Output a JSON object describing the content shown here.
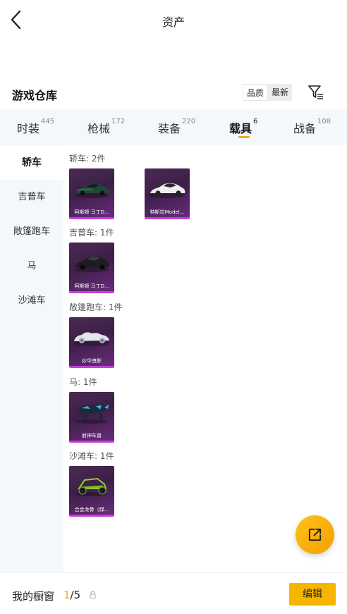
{
  "header": {
    "title": "资产"
  },
  "warehouse": {
    "title": "游戏仓库",
    "sort_options": [
      "品质",
      "最新"
    ],
    "active_sort": "品质"
  },
  "tabs": [
    {
      "label": "时装",
      "count": "445"
    },
    {
      "label": "枪械",
      "count": "172"
    },
    {
      "label": "装备",
      "count": "220"
    },
    {
      "label": "载具",
      "count": "6"
    },
    {
      "label": "战备",
      "count": "108"
    }
  ],
  "active_tab": "载具",
  "sidebar": {
    "items": [
      "轿车",
      "吉普车",
      "敞篷跑车",
      "马",
      "沙滩车"
    ],
    "active": "轿车"
  },
  "sections": [
    {
      "label": "轿车: 2件",
      "items": [
        {
          "name": "阿斯顿·马丁D...",
          "icon": "dark-green-sports-car"
        },
        {
          "name": "特斯拉Model...",
          "icon": "white-tesla-car"
        }
      ]
    },
    {
      "label": "吉普车: 1件",
      "items": [
        {
          "name": "阿斯顿·马丁D...",
          "icon": "dark-suv"
        }
      ]
    },
    {
      "label": "敞篷跑车: 1件",
      "items": [
        {
          "name": "纱华曳影",
          "icon": "white-classic-convertible"
        }
      ]
    },
    {
      "label": "马: 1件",
      "items": [
        {
          "name": "射神车兽",
          "icon": "blue-mech-beast"
        }
      ]
    },
    {
      "label": "沙滩车: 1件",
      "items": [
        {
          "name": "合金龙骨（绿...",
          "icon": "green-dune-buggy"
        }
      ]
    }
  ],
  "showcase": {
    "label": "我的橱窗",
    "current": "1",
    "total": "/5"
  },
  "edit_label": "编辑",
  "colors": {
    "accent": "#f5a623",
    "edit_button": "#f7b500",
    "card_border": "#c83dd8",
    "card_bg": "#4a2a52"
  }
}
